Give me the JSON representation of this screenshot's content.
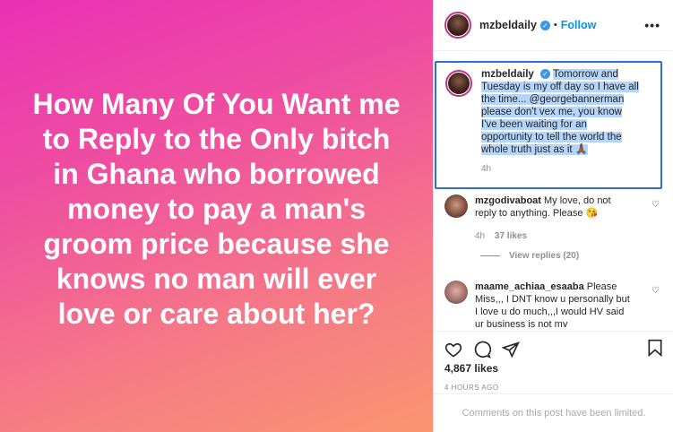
{
  "post_image": {
    "text": "How Many Of You Want me to Reply to the Only bitch in Ghana who borrowed money to pay a man's groom price because she knows no man will ever love or care about her?"
  },
  "header": {
    "username": "mzbeldaily",
    "separator": "•",
    "follow_label": "Follow",
    "more_label": "•••"
  },
  "caption": {
    "username": "mzbeldaily",
    "text": "Tomorrow and Tuesday is my off day so I have all the time... @georgebannerman please don't vex me, you know I've been waiting for an opportunity to tell the world the whole truth just as it 🙏🏾",
    "time": "4h"
  },
  "comments": [
    {
      "username": "mzgodivaboat",
      "text": "My love, do not reply to anything. Please 😘",
      "time": "4h",
      "likes": "37 likes"
    },
    {
      "username": "maame_achiaa_esaaba",
      "text": "Please Miss,,, I DNT know u personally but I love u do much,,,I would HV said ur business is not my"
    }
  ],
  "view_replies": "View replies (20)",
  "likes": "4,867 likes",
  "post_time": "4 HOURS AGO",
  "comments_limited": "Comments on this post have been limited.",
  "colors": {
    "accent": "#0095f6",
    "highlight": "#b4d5fe",
    "selection_border": "#2e6fd3",
    "gradient_start": "#e931b5",
    "gradient_end": "#fb9470"
  }
}
